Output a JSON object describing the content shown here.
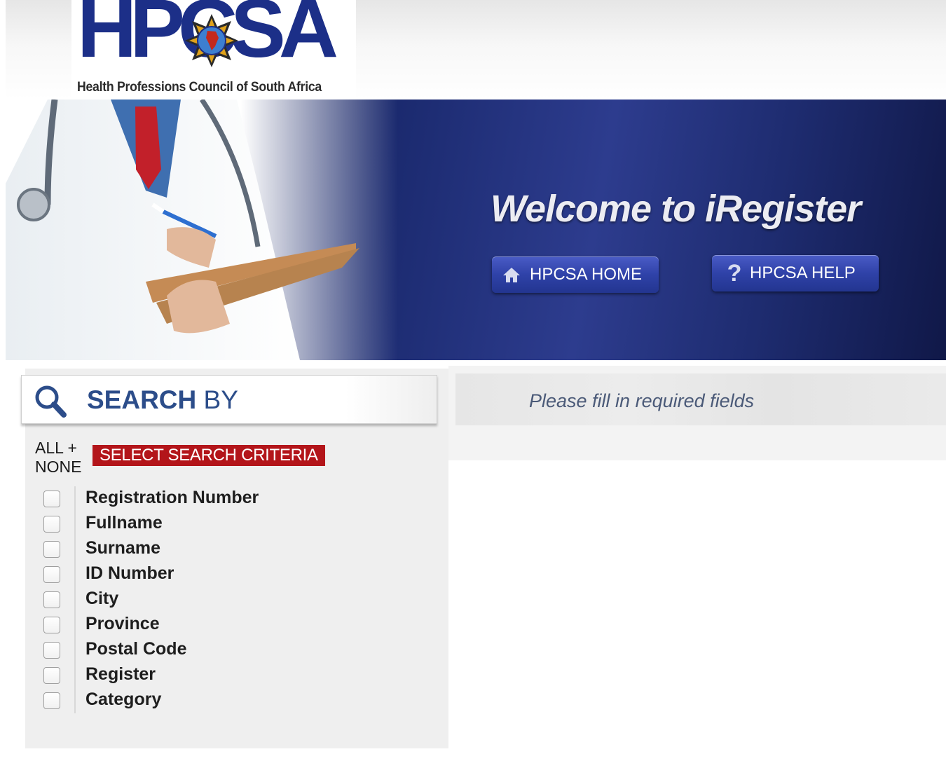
{
  "header": {
    "logo_word": "HPCSA",
    "logo_subtitle": "Health Professions Council of South Africa"
  },
  "banner": {
    "welcome": "Welcome to iRegister",
    "home_button": {
      "label": "HPCSA HOME",
      "icon": "home-icon"
    },
    "help_button": {
      "label": "HPCSA HELP",
      "icon": "question-icon"
    },
    "background_color": "#1b2a6f"
  },
  "search": {
    "title_bold": "SEARCH",
    "title_rest": " BY",
    "all_label": "ALL +",
    "none_label": "NONE",
    "criteria_label": "SELECT SEARCH CRITERIA",
    "criteria_color": "#b3151a",
    "options": [
      "Registration Number",
      "Fullname",
      "Surname",
      "ID Number",
      "City",
      "Province",
      "Postal Code",
      "Register",
      "Category"
    ]
  },
  "message": {
    "text": "Please fill in required fields"
  }
}
